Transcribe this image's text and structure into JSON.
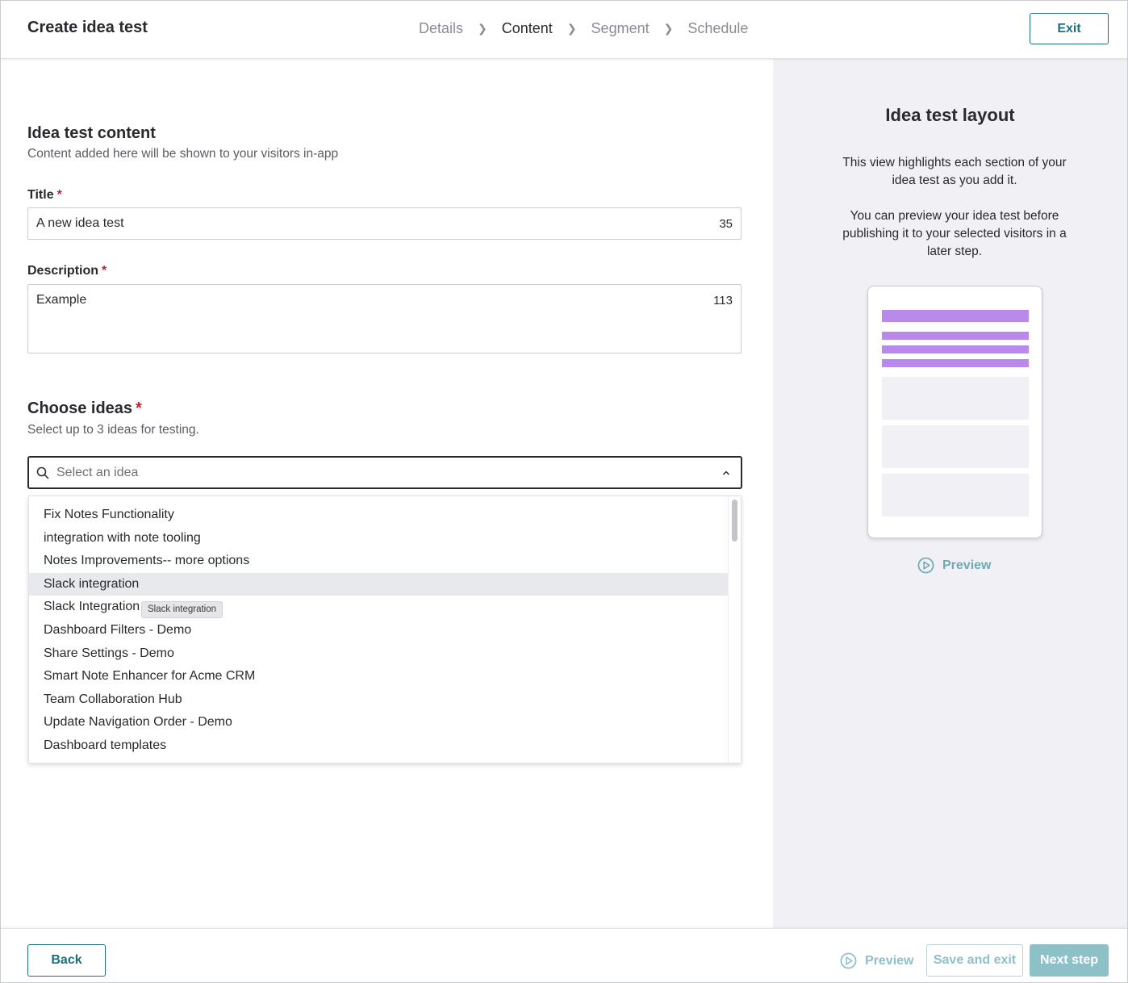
{
  "header": {
    "title": "Create idea test",
    "steps": [
      "Details",
      "Content",
      "Segment",
      "Schedule"
    ],
    "active_step": "Content",
    "exit_label": "Exit"
  },
  "content": {
    "section_title": "Idea test content",
    "section_subtitle": "Content added here will be shown to your visitors in-app",
    "title_label": "Title",
    "title_value": "A new idea test",
    "title_count": "35",
    "description_label": "Description",
    "description_value": "Example",
    "description_count": "113",
    "required_mark": "*"
  },
  "ideas": {
    "title": "Choose ideas",
    "subtitle": "Select up to 3 ideas for testing.",
    "placeholder": "Select an idea",
    "options": [
      "Fix Notes Functionality",
      "integration with note tooling",
      "Notes Improvements-- more options",
      "Slack integration",
      "Slack Integration",
      "Dashboard Filters - Demo",
      "Share Settings - Demo",
      "Smart Note Enhancer for Acme CRM",
      "Team Collaboration Hub",
      "Update Navigation Order - Demo",
      "Dashboard templates"
    ],
    "highlighted_option": "Slack integration",
    "tooltip": "Slack integration"
  },
  "side": {
    "title": "Idea test layout",
    "paragraph1": "This view highlights each section of your idea test as you add it.",
    "paragraph2": "You can preview your idea test before publishing it to your selected visitors in a later step.",
    "preview_label": "Preview"
  },
  "footer": {
    "back_label": "Back",
    "preview_label": "Preview",
    "save_exit_label": "Save and exit",
    "next_label": "Next step"
  },
  "colors": {
    "accent": "#1d6f7c",
    "highlight_bar": "#b989ec",
    "required": "#cc1f2a",
    "panel_bg": "#f1f1f5"
  }
}
